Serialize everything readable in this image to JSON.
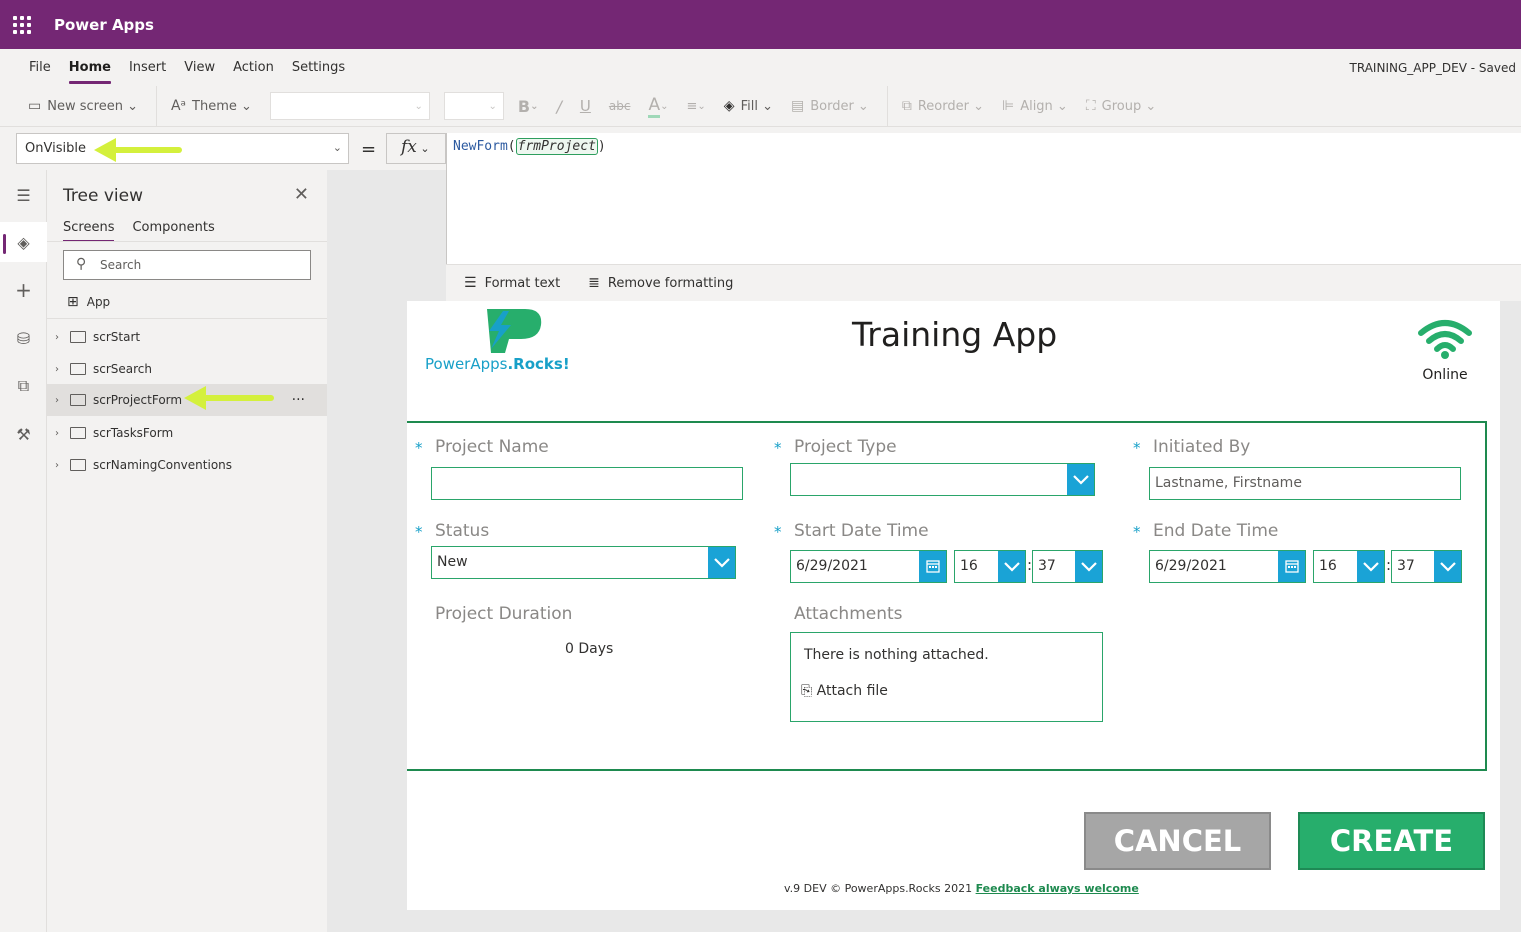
{
  "app": {
    "name": "Power Apps"
  },
  "menu": {
    "items": [
      "File",
      "Home",
      "Insert",
      "View",
      "Action",
      "Settings"
    ],
    "active": "Home",
    "saved_status": "TRAINING_APP_DEV - Saved"
  },
  "toolbar": {
    "new_screen": "New screen",
    "theme": "Theme",
    "fill": "Fill",
    "border": "Border",
    "reorder": "Reorder",
    "align": "Align",
    "group": "Group"
  },
  "formula_bar": {
    "property": "OnVisible",
    "equals": "=",
    "fx": "fx",
    "function": "NewForm",
    "argument": "frmProject",
    "format_text": "Format text",
    "remove_formatting": "Remove formatting"
  },
  "tree": {
    "title": "Tree view",
    "tabs": [
      "Screens",
      "Components"
    ],
    "search_placeholder": "Search",
    "app_node": "App",
    "screens": [
      "scrStart",
      "scrSearch",
      "scrProjectForm",
      "scrTasksForm",
      "scrNamingConventions"
    ],
    "selected": "scrProjectForm",
    "more": "···"
  },
  "canvas": {
    "logo_text_plain": "PowerApps",
    "logo_text_bold": ".Rocks!",
    "title": "Training App",
    "status": "Online",
    "form": {
      "required_mark": "*",
      "project_name": {
        "label": "Project Name",
        "value": ""
      },
      "project_type": {
        "label": "Project Type",
        "value": ""
      },
      "initiated_by": {
        "label": "Initiated By",
        "placeholder": "Lastname, Firstname"
      },
      "status": {
        "label": "Status",
        "value": "New"
      },
      "start": {
        "label": "Start Date Time",
        "date": "6/29/2021",
        "hour": "16",
        "minute": "37"
      },
      "end": {
        "label": "End Date Time",
        "date": "6/29/2021",
        "hour": "16",
        "minute": "37"
      },
      "colon": ":",
      "duration": {
        "label": "Project Duration",
        "value": "0 Days"
      },
      "attachments": {
        "label": "Attachments",
        "empty_text": "There is nothing attached.",
        "attach_link": "Attach file"
      }
    },
    "buttons": {
      "cancel": "CANCEL",
      "create": "CREATE"
    },
    "footer": {
      "text": "v.9 DEV © PowerApps.Rocks 2021",
      "link": "Feedback always welcome"
    }
  },
  "colors": {
    "brand": "#742774",
    "accent_blue": "#1aa3d6",
    "form_green": "#1e8a4f",
    "create_green": "#27ae6c",
    "cancel_gray": "#a6a6a6",
    "arrow_yellow": "#d4f03c"
  }
}
